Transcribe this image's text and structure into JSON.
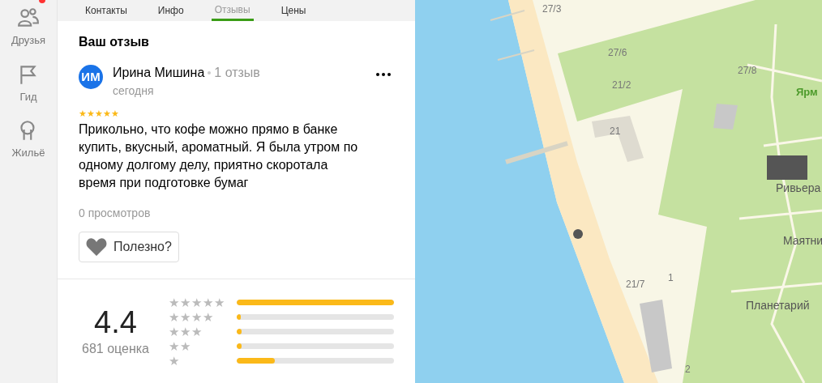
{
  "sidebar": {
    "notification": true,
    "items": [
      {
        "kind": "friends",
        "label": "Друзья"
      },
      {
        "kind": "guide",
        "label": "Гид"
      },
      {
        "kind": "housing",
        "label": "Жильё"
      }
    ]
  },
  "tabs": [
    {
      "label": "Контакты",
      "selected": false
    },
    {
      "label": "Инфо",
      "selected": false
    },
    {
      "label": "Отзывы",
      "selected": true
    },
    {
      "label": "Цены",
      "selected": false
    }
  ],
  "your_review": {
    "heading": "Ваш отзыв",
    "author": {
      "initials": "ИМ",
      "name": "Ирина Мишина",
      "reviews": "1 отзыв",
      "date": "сегодня"
    },
    "stars": 5,
    "text": "Прикольно, что кофе можно прямо в банке купить, вкусный, ароматный. Я была утром по одному долгому делу, приятно скоротала время при подготовке бумаг",
    "views": "0 просмотров",
    "helpful_button": "Полезно?"
  },
  "rating": {
    "score": "4.4",
    "count": "681 оценка",
    "distribution": [
      {
        "label": "★★★★★",
        "level": 1.0
      },
      {
        "label": "★★★★",
        "level": 0.02
      },
      {
        "label": "★★★",
        "level": 0.03
      },
      {
        "label": "★★",
        "level": 0.03
      },
      {
        "label": "★",
        "level": 0.24
      }
    ]
  },
  "map": {
    "labels": [
      {
        "text": "27/3",
        "kind": "house"
      },
      {
        "text": "27/6",
        "kind": "house"
      },
      {
        "text": "21/2",
        "kind": "house"
      },
      {
        "text": "27/8",
        "kind": "house"
      },
      {
        "text": "Ярм",
        "kind": "park"
      },
      {
        "text": "21",
        "kind": "house"
      },
      {
        "text": "Ривьера",
        "kind": "place"
      },
      {
        "text": "Маятни",
        "kind": "place"
      },
      {
        "text": "21/7",
        "kind": "house"
      },
      {
        "text": "1",
        "kind": "house"
      },
      {
        "text": "Планетарий",
        "kind": "place"
      },
      {
        "text": "2",
        "kind": "house"
      }
    ]
  }
}
